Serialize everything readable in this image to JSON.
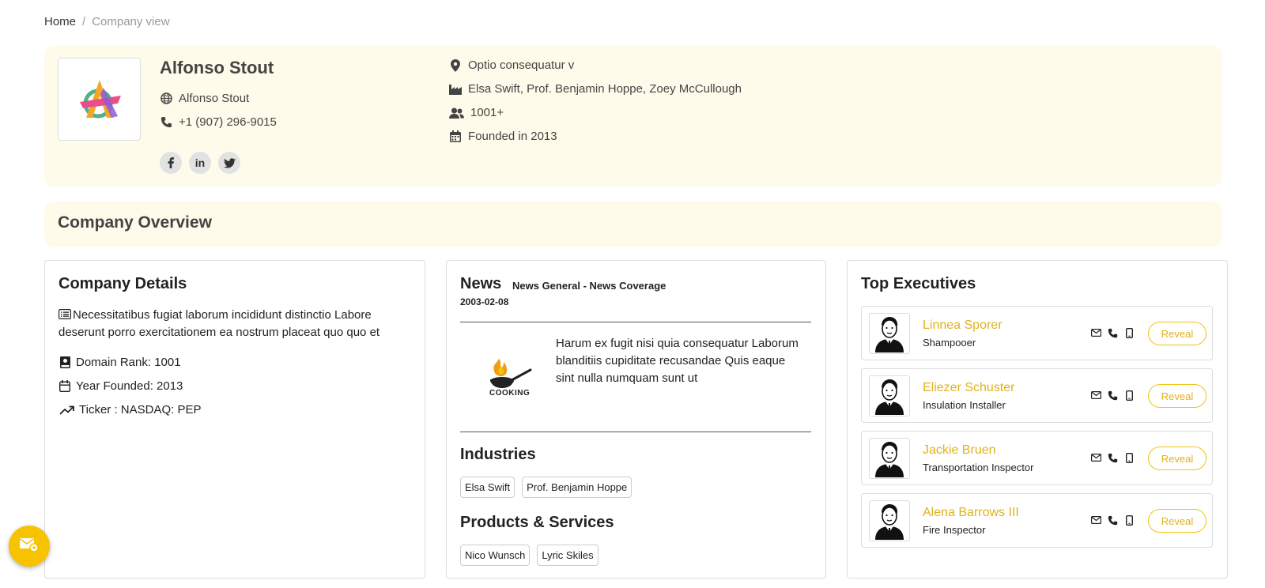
{
  "breadcrumb": {
    "home": "Home",
    "separator": "/",
    "current": "Company view"
  },
  "company": {
    "name": "Alfonso Stout",
    "website": "Alfonso Stout",
    "phone": "+1 (907) 296-9015",
    "location": "Optio consequatur v",
    "founders": "Elsa Swift, Prof. Benjamin Hoppe, Zoey McCullough",
    "employees": "1001+",
    "founded": "Founded in 2013",
    "socials": [
      "f",
      "in",
      "twitter"
    ]
  },
  "overview": {
    "title": "Company Overview"
  },
  "details": {
    "title": "Company Details",
    "description": "Necessitatibus fugiat laborum incididunt distinctio Labore deserunt porro exercitationem ea nostrum placeat quo quo et",
    "domain_rank": "Domain Rank: 1001",
    "year_founded": "Year Founded: 2013",
    "ticker": "Ticker : NASDAQ: PEP"
  },
  "news": {
    "title": "News",
    "subtitle": "News General - News Coverage",
    "date": "2003-02-08",
    "text": "Harum ex fugit nisi quia consequatur Laborum blanditiis cupiditate recusandae Quis eaque sint nulla numquam sunt ut",
    "image_label": "COOKING",
    "industries_title": "Industries",
    "industries": [
      "Elsa Swift",
      "Prof. Benjamin Hoppe"
    ],
    "products_title": "Products & Services",
    "products": [
      "Nico Wunsch",
      "Lyric Skiles"
    ]
  },
  "executives": {
    "title": "Top Executives",
    "reveal_label": "Reveal",
    "items": [
      {
        "name": "Linnea Sporer",
        "title": "Shampooer"
      },
      {
        "name": "Eliezer Schuster",
        "title": "Insulation Installer"
      },
      {
        "name": "Jackie Bruen",
        "title": "Transportation Inspector"
      },
      {
        "name": "Alena Barrows III",
        "title": "Fire Inspector"
      }
    ]
  },
  "colors": {
    "accent": "#f7c300",
    "header_bg": "#fffbea",
    "link": "#e0b21a"
  }
}
